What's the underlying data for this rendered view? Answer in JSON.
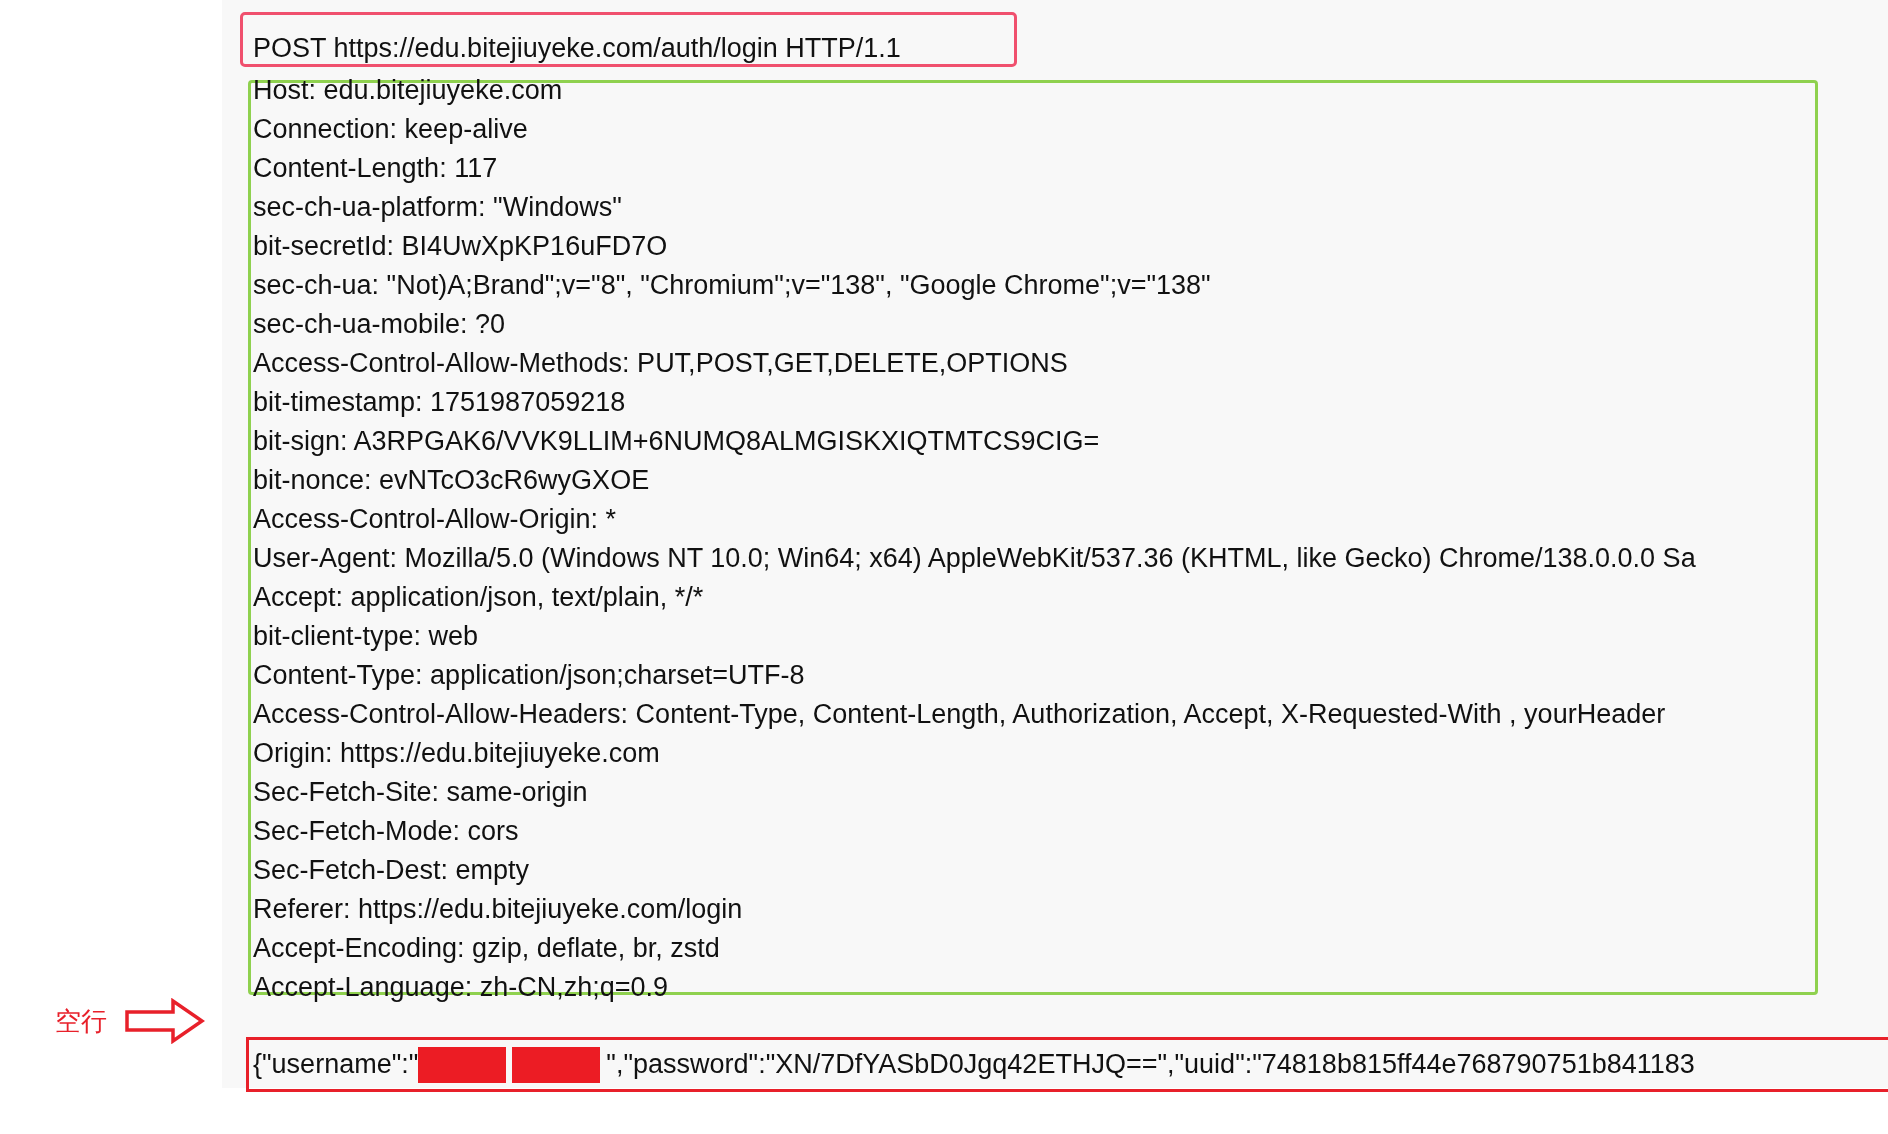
{
  "request_line": "POST https://edu.bitejiuyeke.com/auth/login HTTP/1.1",
  "headers": [
    "Host: edu.bitejiuyeke.com",
    "Connection: keep-alive",
    "Content-Length: 117",
    "sec-ch-ua-platform: \"Windows\"",
    "bit-secretId: BI4UwXpKP16uFD7O",
    "sec-ch-ua: \"Not)A;Brand\";v=\"8\", \"Chromium\";v=\"138\", \"Google Chrome\";v=\"138\"",
    "sec-ch-ua-mobile: ?0",
    "Access-Control-Allow-Methods: PUT,POST,GET,DELETE,OPTIONS",
    "bit-timestamp: 1751987059218",
    "bit-sign: A3RPGAK6/VVK9LLIM+6NUMQ8ALMGISKXIQTMTCS9CIG=",
    "bit-nonce: evNTcO3cR6wyGXOE",
    "Access-Control-Allow-Origin: *",
    "User-Agent: Mozilla/5.0 (Windows NT 10.0; Win64; x64) AppleWebKit/537.36 (KHTML, like Gecko) Chrome/138.0.0.0 Sa",
    "Accept: application/json, text/plain, */*",
    "bit-client-type: web",
    "Content-Type: application/json;charset=UTF-8",
    "Access-Control-Allow-Headers: Content-Type, Content-Length, Authorization, Accept, X-Requested-With , yourHeader",
    "Origin: https://edu.bitejiuyeke.com",
    "Sec-Fetch-Site: same-origin",
    "Sec-Fetch-Mode: cors",
    "Sec-Fetch-Dest: empty",
    "Referer: https://edu.bitejiuyeke.com/login",
    "Accept-Encoding: gzip, deflate, br, zstd",
    "Accept-Language: zh-CN,zh;q=0.9"
  ],
  "blank_line_label": "空行",
  "body": {
    "before_redaction": "{\"username\":\"",
    "after_redaction": "\",\"password\":\"XN/7DfYASbD0Jgq42ETHJQ==\",\"uuid\":\"74818b815ff44e768790751b841183"
  }
}
